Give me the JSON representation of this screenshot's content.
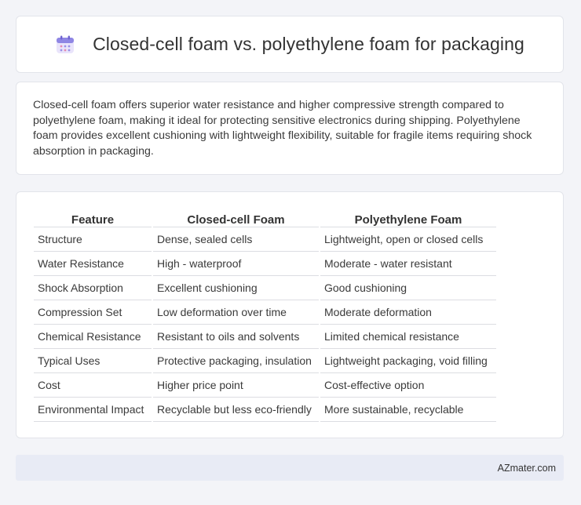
{
  "header": {
    "icon": "calendar-icon",
    "title": "Closed-cell foam vs. polyethylene foam for packaging"
  },
  "summary": {
    "text": "Closed-cell foam offers superior water resistance and higher compressive strength compared to polyethylene foam, making it ideal for protecting sensitive electronics during shipping. Polyethylene foam provides excellent cushioning with lightweight flexibility, suitable for fragile items requiring shock absorption in packaging."
  },
  "table": {
    "headers": [
      "Feature",
      "Closed-cell Foam",
      "Polyethylene Foam"
    ],
    "rows": [
      [
        "Structure",
        "Dense, sealed cells",
        "Lightweight, open or closed cells"
      ],
      [
        "Water Resistance",
        "High - waterproof",
        "Moderate - water resistant"
      ],
      [
        "Shock Absorption",
        "Excellent cushioning",
        "Good cushioning"
      ],
      [
        "Compression Set",
        "Low deformation over time",
        "Moderate deformation"
      ],
      [
        "Chemical Resistance",
        "Resistant to oils and solvents",
        "Limited chemical resistance"
      ],
      [
        "Typical Uses",
        "Protective packaging, insulation",
        "Lightweight packaging, void filling"
      ],
      [
        "Cost",
        "Higher price point",
        "Cost-effective option"
      ],
      [
        "Environmental Impact",
        "Recyclable but less eco-friendly",
        "More sustainable, recyclable"
      ]
    ]
  },
  "footer": {
    "brand": "AZmater.com"
  },
  "colors": {
    "background": "#f3f4f8",
    "card": "#ffffff",
    "footer_bg": "#e8ebf5",
    "icon_accent": "#7b6fd6"
  }
}
